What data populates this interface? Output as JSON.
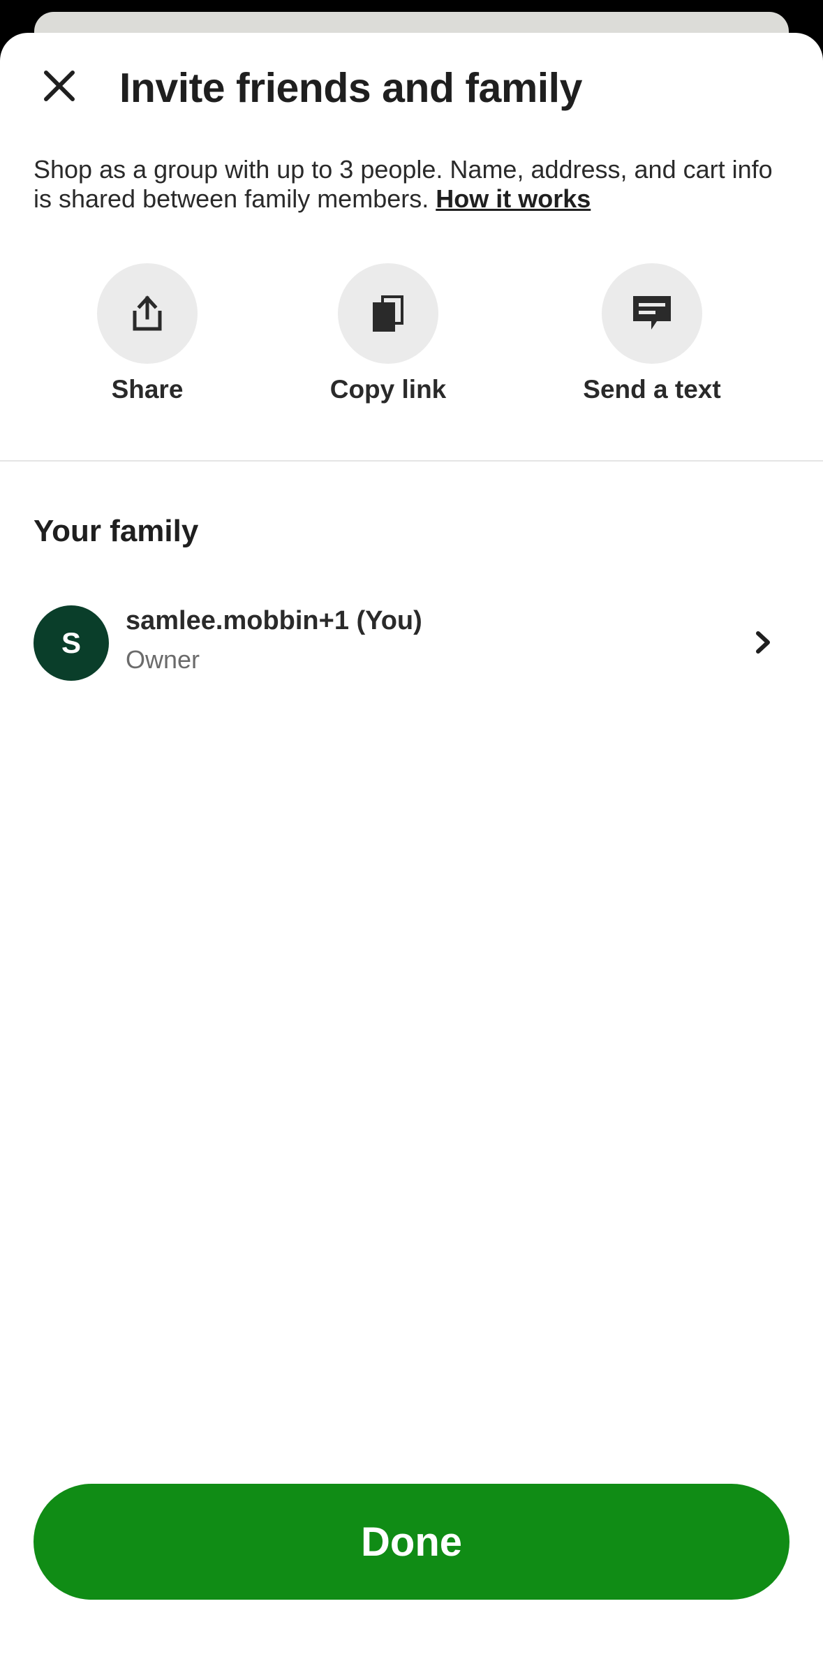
{
  "header": {
    "title": "Invite friends and family",
    "close_icon": "close-icon"
  },
  "intro": {
    "description": "Shop as a group with up to 3 people. Name, address, and cart info is shared between family members.",
    "link_label": "How it works"
  },
  "actions": [
    {
      "label": "Share",
      "icon": "share-icon"
    },
    {
      "label": "Copy link",
      "icon": "copy-icon"
    },
    {
      "label": "Send a text",
      "icon": "message-icon"
    }
  ],
  "family": {
    "heading": "Your family",
    "members": [
      {
        "initial": "S",
        "name": "samlee.mobbin+1 (You)",
        "role": "Owner"
      }
    ]
  },
  "footer": {
    "done_label": "Done"
  },
  "colors": {
    "primary_button": "#108c15",
    "avatar_background": "#0a3e2a",
    "action_circle": "#ebebeb",
    "text_primary": "#1f1f1f",
    "text_secondary": "#6b6b6b"
  }
}
